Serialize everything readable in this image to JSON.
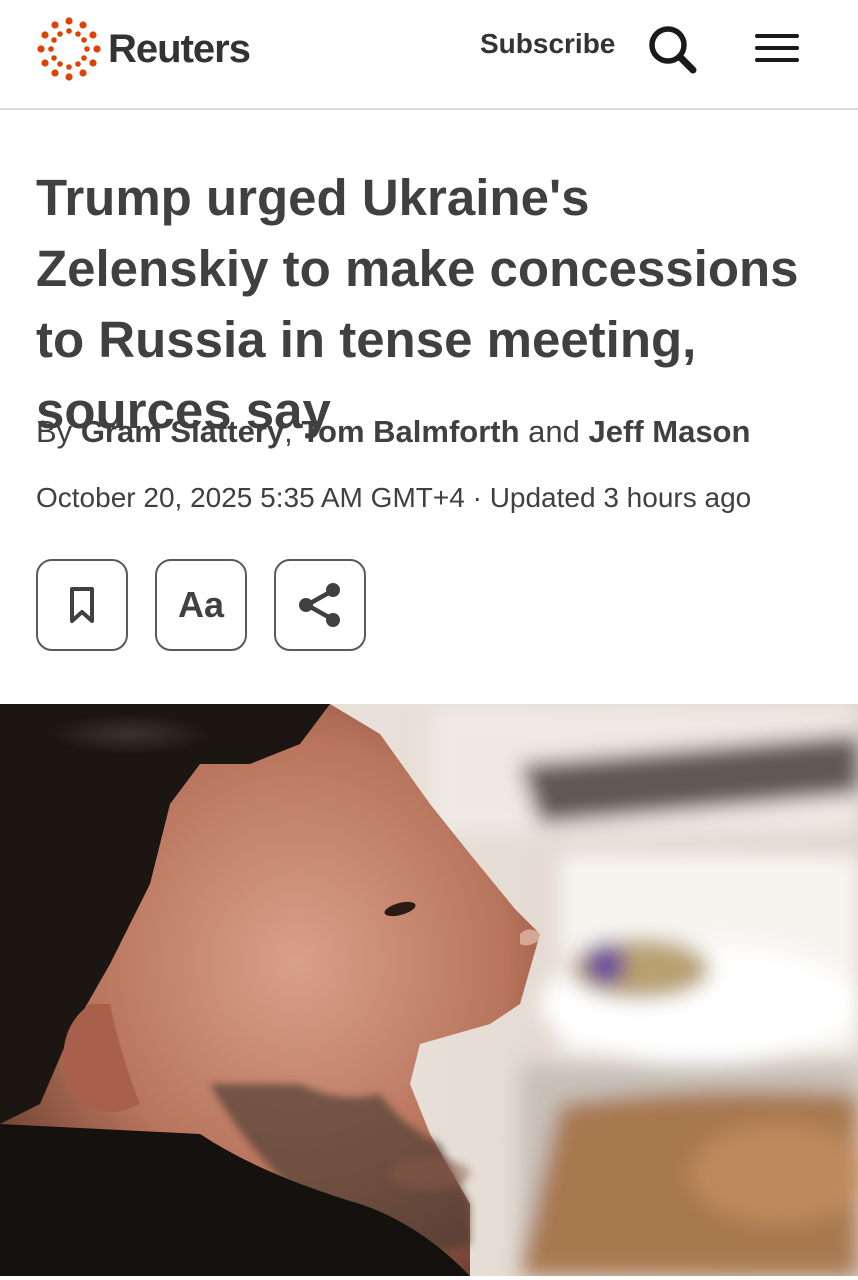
{
  "header": {
    "brand": "Reuters",
    "subscribe_label": "Subscribe",
    "search_icon": "search-icon",
    "menu_icon": "hamburger-menu-icon",
    "brand_color": "#dc4300"
  },
  "article": {
    "headline": "Trump urged Ukraine's Zelenskiy to make concessions to Russia in tense meeting, sources say",
    "byline_prefix": "By",
    "author_1": "Gram Slattery",
    "separator_1": ",",
    "author_2": "Tom Balmforth",
    "separator_2": "and",
    "author_3": "Jeff Mason",
    "date": "October 20, 2025 5:35 AM GMT+4",
    "date_separator": "·",
    "updated": "Updated 3 hours ago"
  },
  "tools": {
    "bookmark_icon": "bookmark-icon",
    "text_size_label": "Aa",
    "share_icon": "share-icon"
  },
  "photo": {
    "subject": "Close-up profile photo of a man with dark hair and stubble"
  }
}
